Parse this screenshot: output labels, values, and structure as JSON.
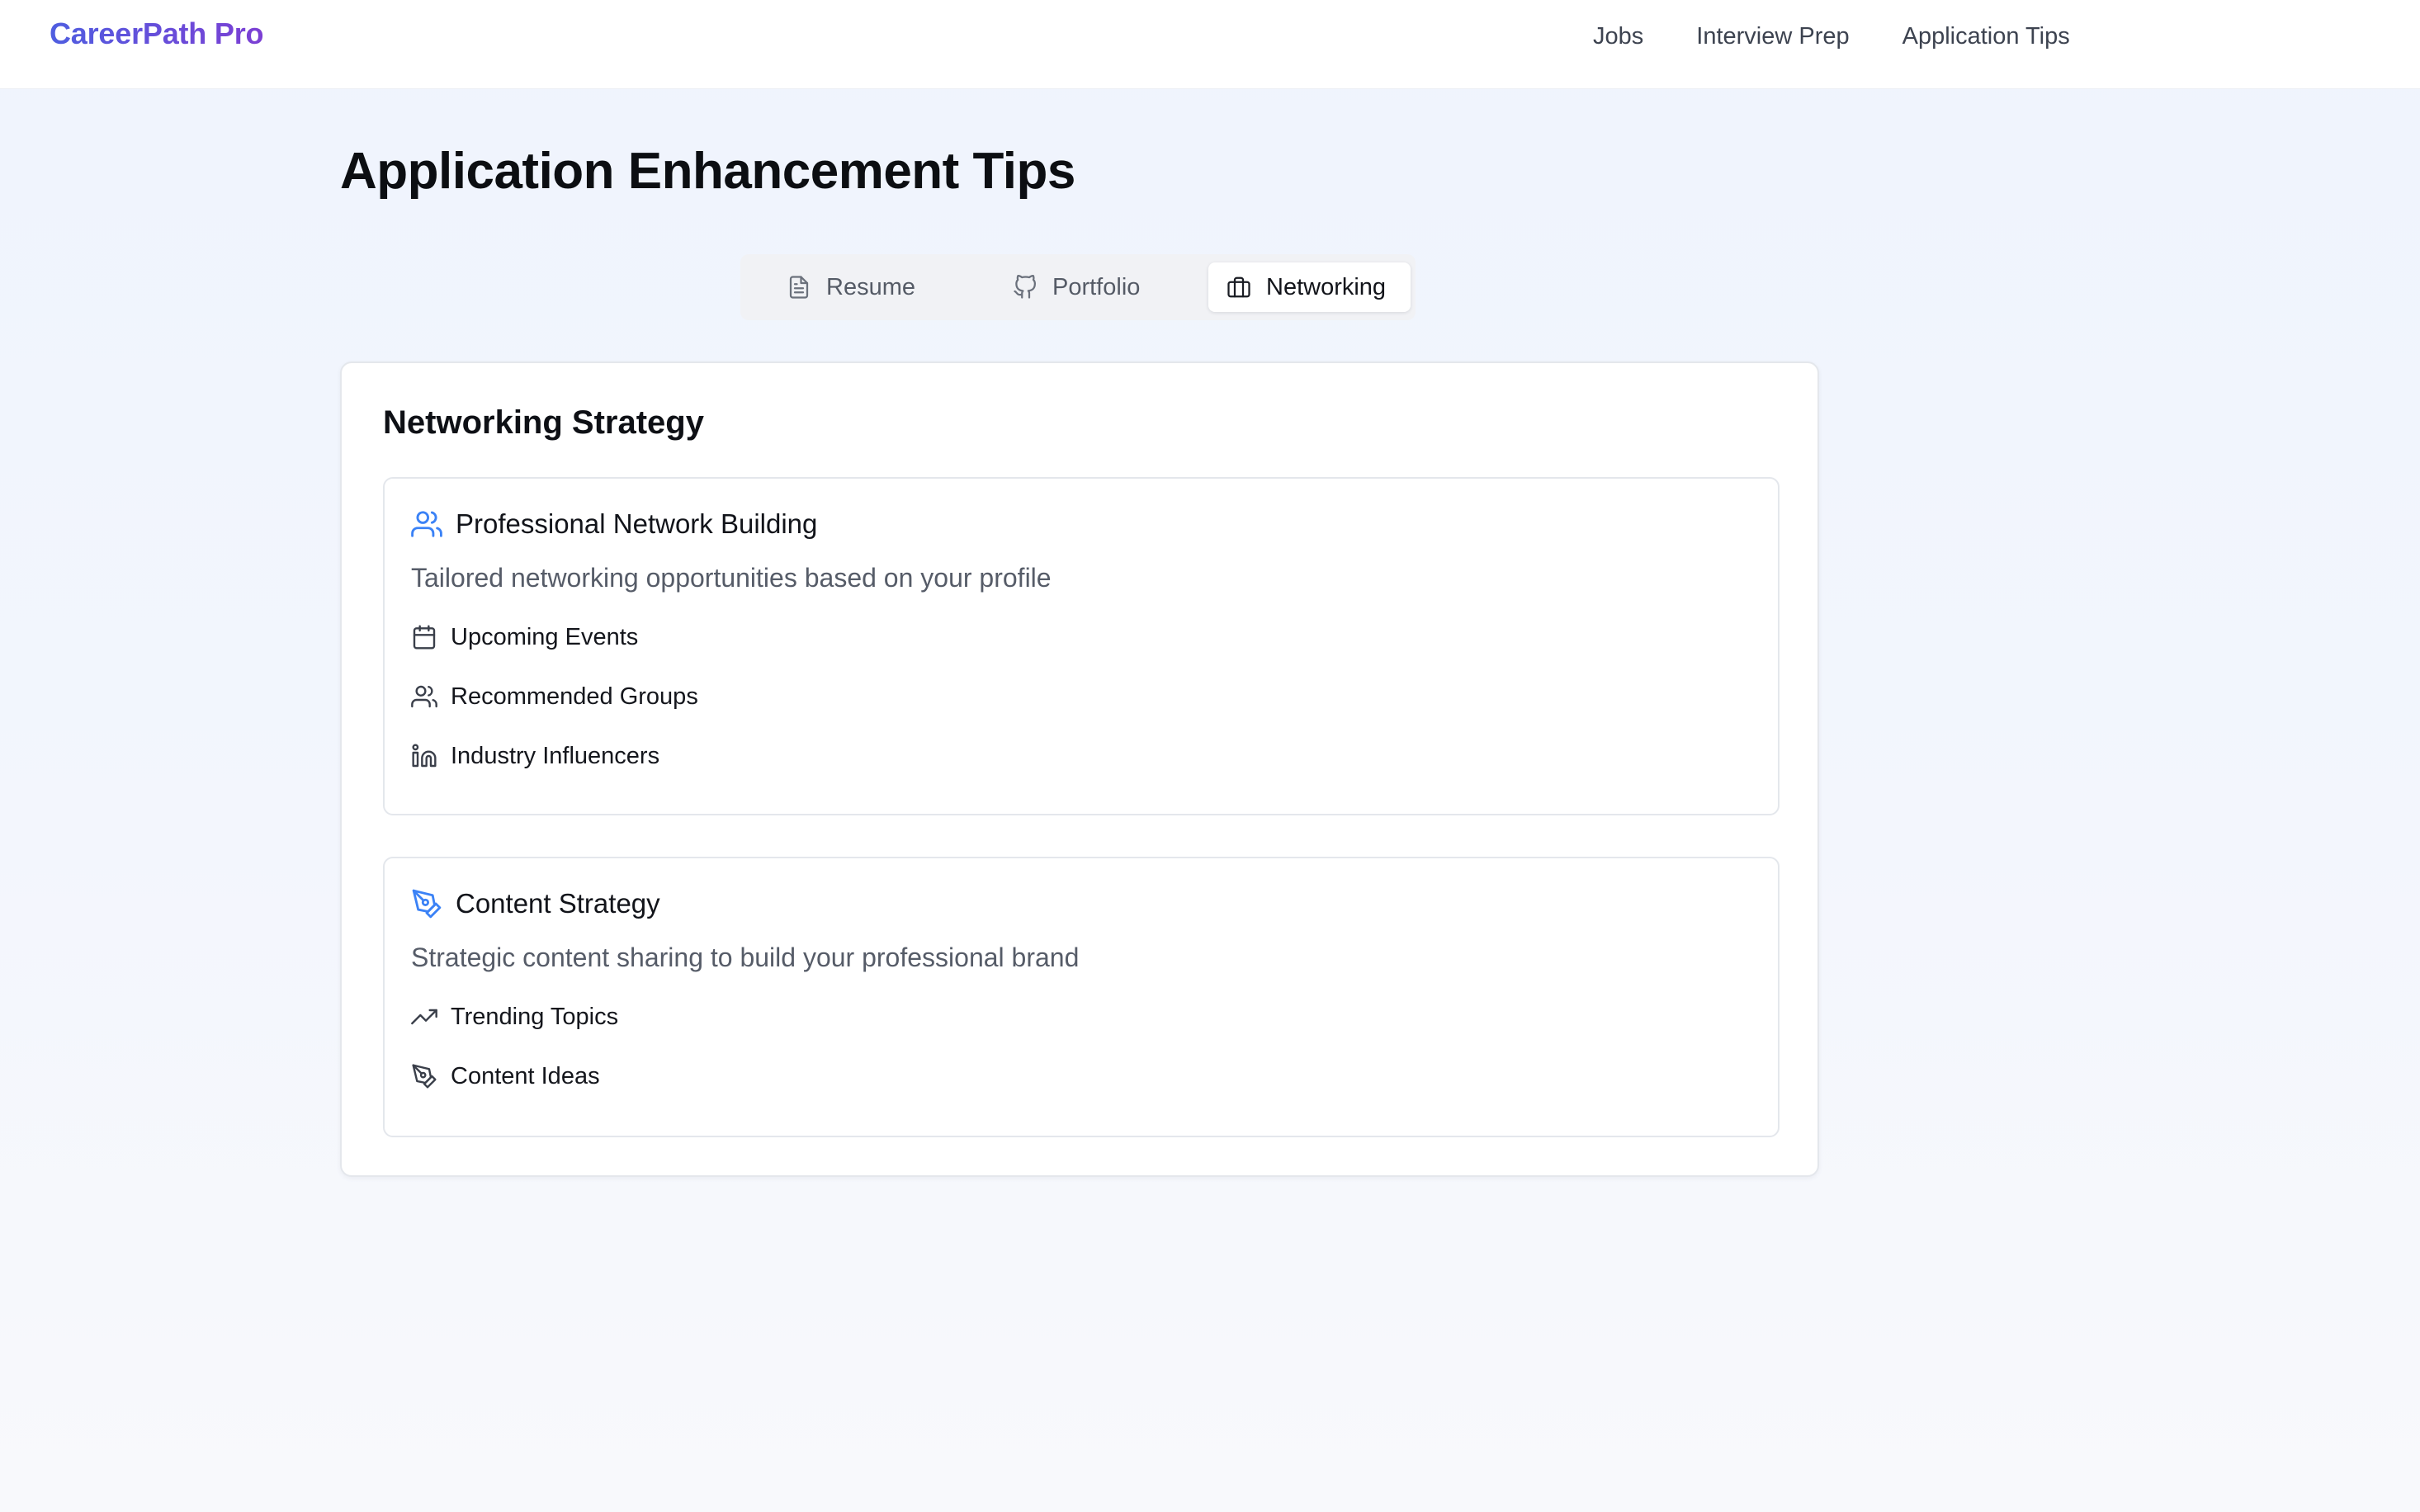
{
  "header": {
    "brand": "CareerPath Pro",
    "nav": [
      "Jobs",
      "Interview Prep",
      "Application Tips"
    ]
  },
  "page": {
    "title": "Application Enhancement Tips"
  },
  "tabs": [
    {
      "label": "Resume",
      "icon": "file-text-icon",
      "active": false
    },
    {
      "label": "Portfolio",
      "icon": "github-icon",
      "active": false
    },
    {
      "label": "Networking",
      "icon": "briefcase-icon",
      "active": true
    }
  ],
  "card": {
    "title": "Networking Strategy",
    "sections": [
      {
        "title": "Professional Network Building",
        "icon": "users-icon",
        "description": "Tailored networking opportunities based on your profile",
        "items": [
          {
            "label": "Upcoming Events",
            "icon": "calendar-icon"
          },
          {
            "label": "Recommended Groups",
            "icon": "users-icon"
          },
          {
            "label": "Industry Influencers",
            "icon": "linkedin-icon"
          }
        ]
      },
      {
        "title": "Content Strategy",
        "icon": "pen-tool-icon",
        "description": "Strategic content sharing to build your professional brand",
        "items": [
          {
            "label": "Trending Topics",
            "icon": "trending-up-icon"
          },
          {
            "label": "Content Ideas",
            "icon": "pen-tool-icon"
          }
        ]
      }
    ]
  },
  "colors": {
    "brand_start": "#4f5ee0",
    "brand_end": "#7c3fd4",
    "accent_icon": "#3b82f6",
    "background": "#eff4fd"
  }
}
